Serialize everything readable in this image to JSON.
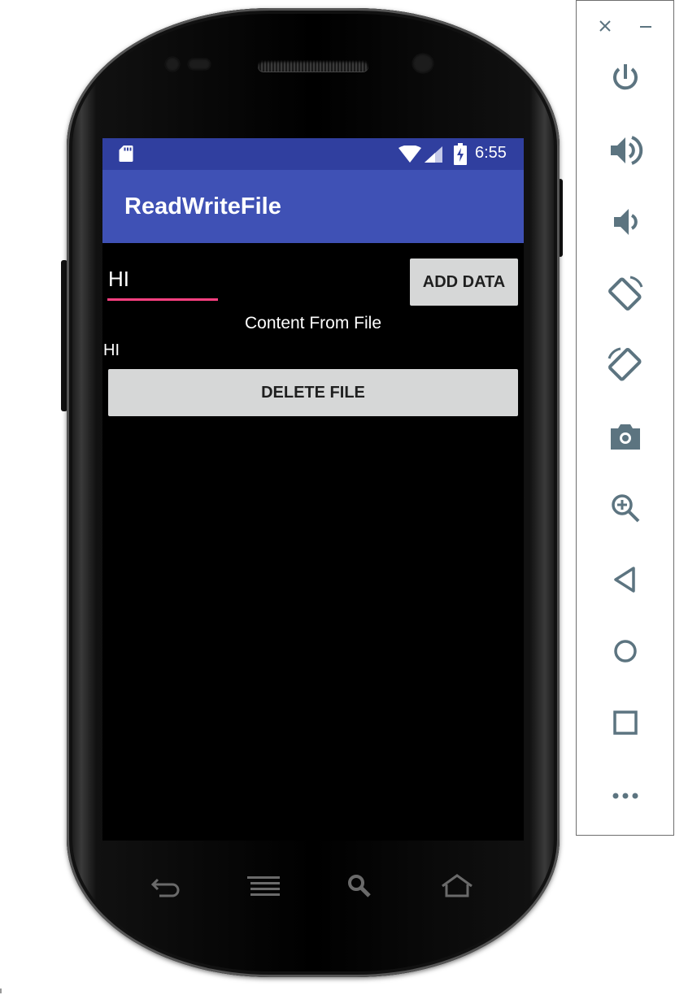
{
  "status_bar": {
    "time": "6:55",
    "icons": [
      "sd-card-icon",
      "wifi-icon",
      "signal-icon",
      "battery-charging-icon"
    ]
  },
  "app_bar": {
    "title": "ReadWriteFile"
  },
  "main": {
    "input_value": "HI",
    "add_button_label": "ADD DATA",
    "content_label": "Content From File",
    "content_value": "HI",
    "delete_button_label": "DELETE FILE"
  },
  "hardware_nav": [
    "back-icon",
    "menu-icon",
    "search-icon",
    "home-icon"
  ],
  "emulator_toolbar": {
    "window_controls": [
      "close-icon",
      "minimize-icon"
    ],
    "buttons": [
      "power-icon",
      "volume-up-icon",
      "volume-down-icon",
      "rotate-left-icon",
      "rotate-right-icon",
      "camera-icon",
      "zoom-icon",
      "back-icon",
      "home-icon",
      "overview-icon",
      "more-icon"
    ]
  },
  "colors": {
    "status_bar": "#303f9f",
    "app_bar": "#3f51b5",
    "accent": "#ff4081",
    "button": "#d6d7d7",
    "toolbar_icon": "#5c7480"
  }
}
